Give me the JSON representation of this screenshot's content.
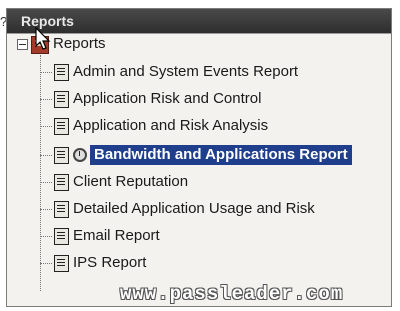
{
  "stray_char": "?",
  "window": {
    "title": "Reports"
  },
  "tree": {
    "root_label": "Reports",
    "items": [
      {
        "label": "Admin and System Events Report",
        "icon": "report-icon"
      },
      {
        "label": "Application Risk and Control",
        "icon": "report-icon"
      },
      {
        "label": "Application and Risk Analysis",
        "icon": "report-icon"
      },
      {
        "label": "Bandwidth and Applications Report",
        "icon": "report-icon",
        "selected": true,
        "badge_icon": "clock-icon"
      },
      {
        "label": "Client Reputation",
        "icon": "report-icon"
      },
      {
        "label": "Detailed Application Usage and Risk",
        "icon": "report-icon"
      },
      {
        "label": "Email Report",
        "icon": "report-icon"
      },
      {
        "label": "IPS Report",
        "icon": "report-icon"
      }
    ]
  },
  "watermark": "www.passleader.com",
  "colors": {
    "selection": "#1f3f8c",
    "titlebar": "#3a3a3a",
    "panel": "#f3f2ee"
  }
}
